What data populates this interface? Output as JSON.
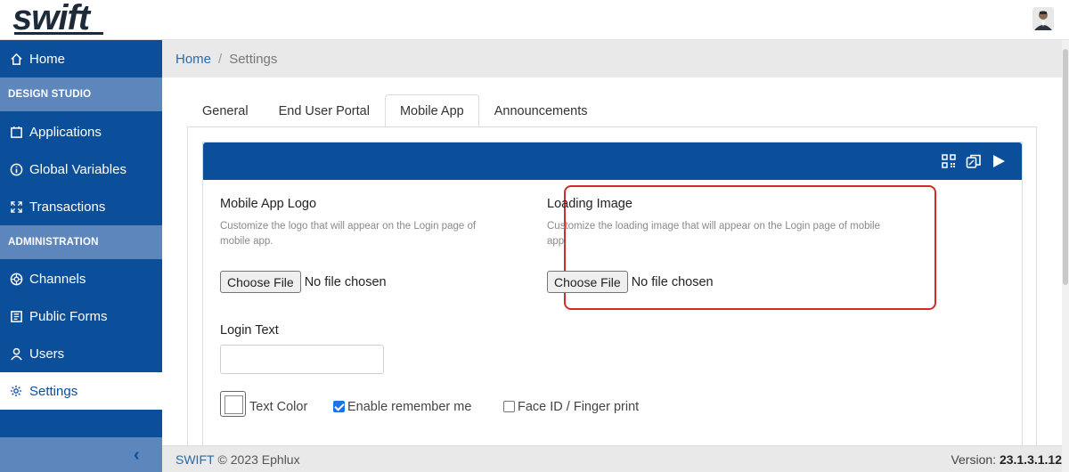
{
  "header": {
    "logo_text": "swift"
  },
  "sidebar": {
    "items": [
      {
        "label": "Home",
        "icon": "home-icon"
      },
      {
        "label": "Applications",
        "icon": "applications-icon"
      },
      {
        "label": "Global Variables",
        "icon": "info-icon"
      },
      {
        "label": "Transactions",
        "icon": "expand-icon"
      },
      {
        "label": "Channels",
        "icon": "channels-icon"
      },
      {
        "label": "Public Forms",
        "icon": "forms-icon"
      },
      {
        "label": "Users",
        "icon": "user-icon"
      },
      {
        "label": "Settings",
        "icon": "gear-icon",
        "active": true
      }
    ],
    "sections": {
      "design_studio": "DESIGN STUDIO",
      "administration": "ADMINISTRATION"
    },
    "collapse_glyph": "‹"
  },
  "breadcrumb": {
    "home": "Home",
    "separator": "/",
    "current": "Settings"
  },
  "tabs": [
    {
      "label": "General"
    },
    {
      "label": "End User Portal"
    },
    {
      "label": "Mobile App",
      "active": true
    },
    {
      "label": "Announcements"
    }
  ],
  "mobile_app": {
    "header_icons": [
      "qr-code-icon",
      "copy-icon",
      "play-icon"
    ],
    "logo": {
      "title": "Mobile App Logo",
      "description": "Customize the logo that will appear on the Login page of mobile app.",
      "button_label": "Choose File",
      "file_status": "No file chosen"
    },
    "loading_image": {
      "title": "Loading Image",
      "description": "Customize the loading image that will appear on the Login page of mobile app.",
      "button_label": "Choose File",
      "file_status": "No file chosen"
    },
    "login_text": {
      "label": "Login Text",
      "value": "",
      "placeholder": ""
    },
    "text_color_label": "Text Color",
    "enable_remember_me": {
      "label": "Enable remember me",
      "checked": true
    },
    "face_id": {
      "label": "Face ID / Finger print",
      "checked": false
    }
  },
  "footer": {
    "brand": "SWIFT",
    "copyright": "© 2023 Ephlux",
    "version_label": "Version:",
    "version": "23.1.3.1.12"
  },
  "colors": {
    "sidebar": "#0b4f9a",
    "section": "#5d86bd",
    "highlight": "#d32a2a",
    "link": "#2a6aa6"
  }
}
